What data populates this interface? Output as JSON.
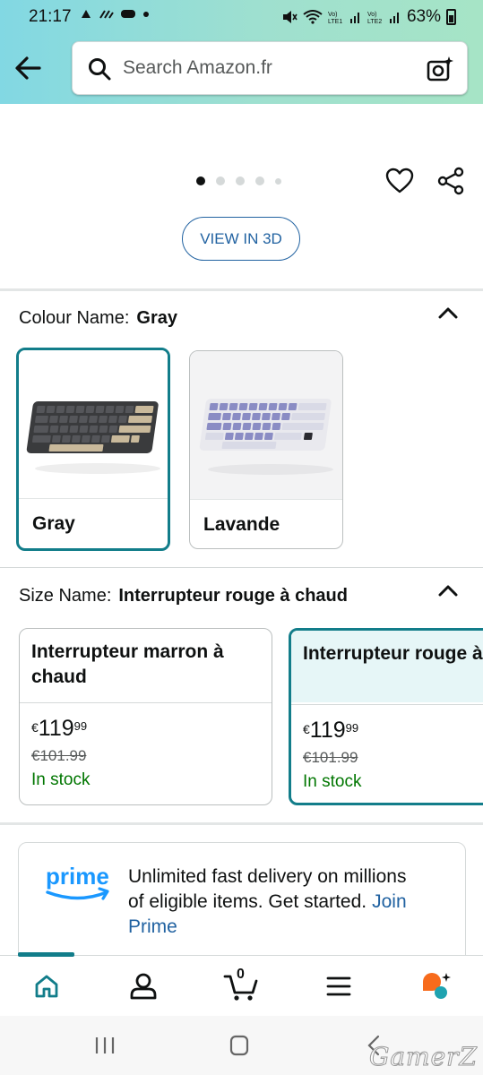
{
  "status_bar": {
    "time": "21:17",
    "battery": "63%",
    "left_icons": [
      "cloud-icon",
      "signal-alt-icon",
      "game-icon",
      "dot-icon"
    ],
    "right_icons": [
      "mute-icon",
      "wifi-icon",
      "volte1-icon",
      "signal1-icon",
      "volte2-icon",
      "signal2-icon",
      "battery-icon"
    ]
  },
  "header": {
    "search_placeholder": "Search Amazon.fr",
    "gradient_colors": [
      "#82d8e3",
      "#a6e4c6"
    ]
  },
  "gallery": {
    "total_images": 5,
    "active_index": 0,
    "view_3d_label": "VIEW IN 3D"
  },
  "colour": {
    "label": "Colour Name:",
    "selected": "Gray",
    "options": [
      {
        "name": "Gray",
        "selected": true
      },
      {
        "name": "Lavande",
        "selected": false
      }
    ]
  },
  "size": {
    "label": "Size Name:",
    "selected": "Interrupteur rouge à chaud",
    "options": [
      {
        "name": "Interrupteur marron à chaud",
        "currency": "€",
        "price_whole": "119",
        "price_fraction": "99",
        "old_price": "€101.99",
        "stock": "In stock",
        "selected": false
      },
      {
        "name": "Interrupteur rouge à chaud",
        "currency": "€",
        "price_whole": "119",
        "price_fraction": "99",
        "old_price": "€101.99",
        "stock": "In stock",
        "selected": true
      }
    ]
  },
  "prime": {
    "logo_text": "prime",
    "text": "Unlimited fast delivery on millions of eligible items. Get started.",
    "link": "Join Prime"
  },
  "bottom_nav": {
    "cart_count": "0",
    "items": [
      "home-icon",
      "account-icon",
      "cart-icon",
      "menu-icon",
      "rufus-icon"
    ]
  },
  "watermark": "GamerZ",
  "colors": {
    "accent": "#127d8a",
    "link": "#2162a1",
    "in_stock": "#007600"
  }
}
